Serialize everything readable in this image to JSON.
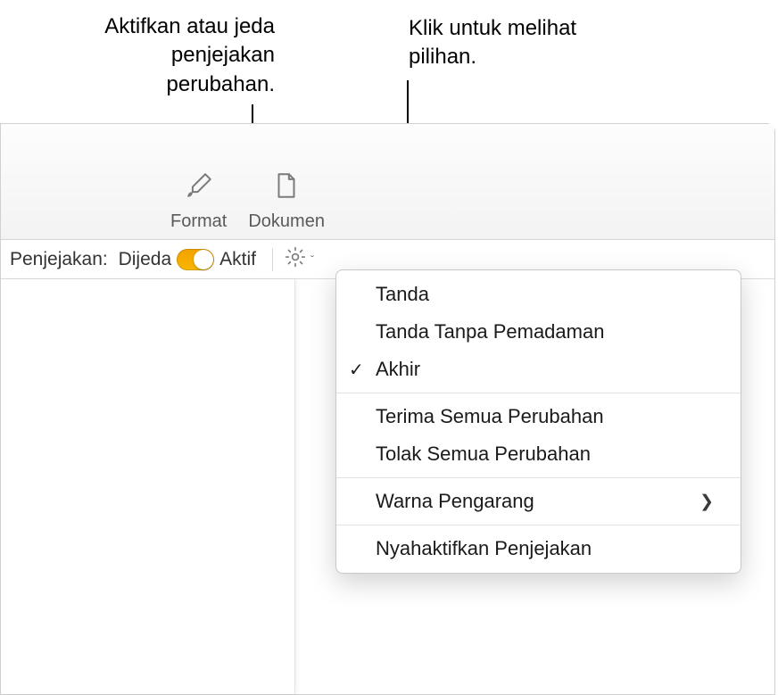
{
  "callouts": {
    "left": "Aktifkan atau jeda penjejakan perubahan.",
    "right": "Klik untuk melihat pilihan."
  },
  "toolbar": {
    "format_label": "Format",
    "document_label": "Dokumen"
  },
  "subbar": {
    "tracking_label": "Penjejakan:",
    "state_paused": "Dijeda",
    "state_active": "Aktif"
  },
  "menu": {
    "items": {
      "markup": "Tanda",
      "markup_no_delete": "Tanda Tanpa Pemadaman",
      "final": "Akhir",
      "accept_all": "Terima Semua Perubahan",
      "reject_all": "Tolak Semua Perubahan",
      "author_color": "Warna Pengarang",
      "disable_tracking": "Nyahaktifkan Penjejakan"
    }
  }
}
